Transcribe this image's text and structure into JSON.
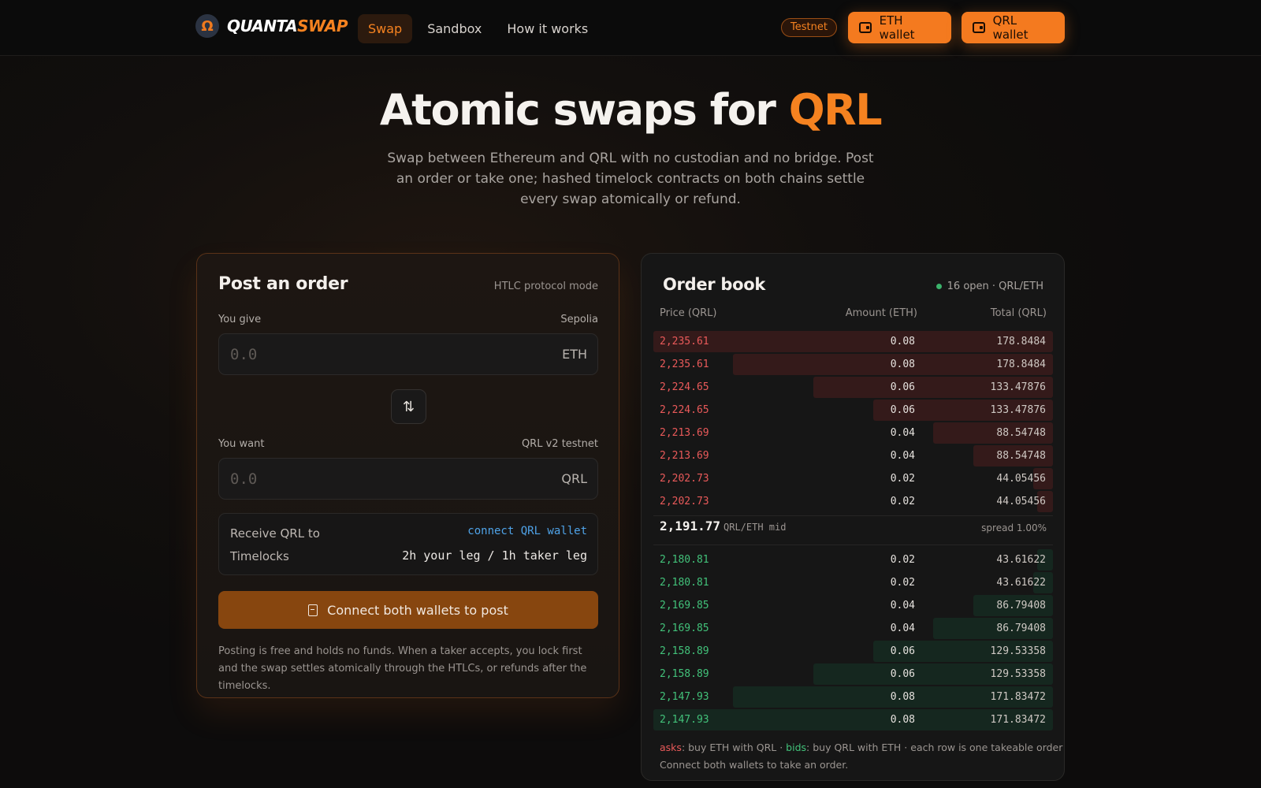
{
  "header": {
    "brand_a": "QUANTA",
    "brand_b": "SWAP",
    "logo_glyph": "Ω",
    "nav": [
      {
        "label": "Swap",
        "active": true
      },
      {
        "label": "Sandbox",
        "active": false
      },
      {
        "label": "How it works",
        "active": false
      }
    ],
    "network_badge": "Testnet",
    "eth_wallet_label": "ETH wallet",
    "qrl_wallet_label": "QRL wallet"
  },
  "hero": {
    "title_a": "Atomic swaps for ",
    "title_b": "QRL",
    "subtitle": "Swap between Ethereum and QRL with no custodian and no bridge. Post an order or take one; hashed timelock contracts on both chains settle every swap atomically or refund."
  },
  "post_order": {
    "title": "Post an order",
    "mode": "HTLC protocol mode",
    "give_label": "You give",
    "give_chain": "Sepolia",
    "give_value": "0.0",
    "give_unit": "ETH",
    "swap_glyph": "⇅",
    "want_label": "You want",
    "want_chain": "QRL v2 testnet",
    "want_value": "0.0",
    "want_unit": "QRL",
    "receive_label": "Receive QRL to",
    "receive_action": "connect QRL wallet",
    "timelocks_label": "Timelocks",
    "timelocks_value": "2h your leg / 1h taker leg",
    "submit_label": "Connect both wallets to post",
    "note": "Posting is free and holds no funds. When a taker accepts, you lock first and the swap settles atomically through the HTLCs, or refunds after the timelocks."
  },
  "order_book": {
    "title": "Order book",
    "status": "16 open · QRL/ETH",
    "columns": [
      "Price (QRL)",
      "Amount (ETH)",
      "Total (QRL)"
    ],
    "asks": [
      {
        "price": "2,235.61",
        "amount": "0.08",
        "total": "178.8484",
        "depth": 1.0
      },
      {
        "price": "2,235.61",
        "amount": "0.08",
        "total": "178.8484",
        "depth": 0.8
      },
      {
        "price": "2,224.65",
        "amount": "0.06",
        "total": "133.47876",
        "depth": 0.6
      },
      {
        "price": "2,224.65",
        "amount": "0.06",
        "total": "133.47876",
        "depth": 0.45
      },
      {
        "price": "2,213.69",
        "amount": "0.04",
        "total": "88.54748",
        "depth": 0.3
      },
      {
        "price": "2,213.69",
        "amount": "0.04",
        "total": "88.54748",
        "depth": 0.2
      },
      {
        "price": "2,202.73",
        "amount": "0.02",
        "total": "44.05456",
        "depth": 0.05
      },
      {
        "price": "2,202.73",
        "amount": "0.02",
        "total": "44.05456",
        "depth": 0.04
      }
    ],
    "mid_price": "2,191.77",
    "mid_label": "QRL/ETH mid",
    "spread": "spread 1.00%",
    "bids": [
      {
        "price": "2,180.81",
        "amount": "0.02",
        "total": "43.61622",
        "depth": 0.04
      },
      {
        "price": "2,180.81",
        "amount": "0.02",
        "total": "43.61622",
        "depth": 0.05
      },
      {
        "price": "2,169.85",
        "amount": "0.04",
        "total": "86.79408",
        "depth": 0.2
      },
      {
        "price": "2,169.85",
        "amount": "0.04",
        "total": "86.79408",
        "depth": 0.3
      },
      {
        "price": "2,158.89",
        "amount": "0.06",
        "total": "129.53358",
        "depth": 0.45
      },
      {
        "price": "2,158.89",
        "amount": "0.06",
        "total": "129.53358",
        "depth": 0.6
      },
      {
        "price": "2,147.93",
        "amount": "0.08",
        "total": "171.83472",
        "depth": 0.8
      },
      {
        "price": "2,147.93",
        "amount": "0.08",
        "total": "171.83472",
        "depth": 1.0
      }
    ],
    "legend_asks_word": "asks",
    "legend_asks_text": ": buy ETH with QRL · ",
    "legend_bids_word": "bids",
    "legend_bids_text": ": buy QRL with ETH · each row is one takeable order",
    "legend_note": "Connect both wallets to take an order."
  },
  "colors": {
    "accent": "#f58220",
    "ask": "#ea5a5a",
    "bid": "#42c27a"
  }
}
